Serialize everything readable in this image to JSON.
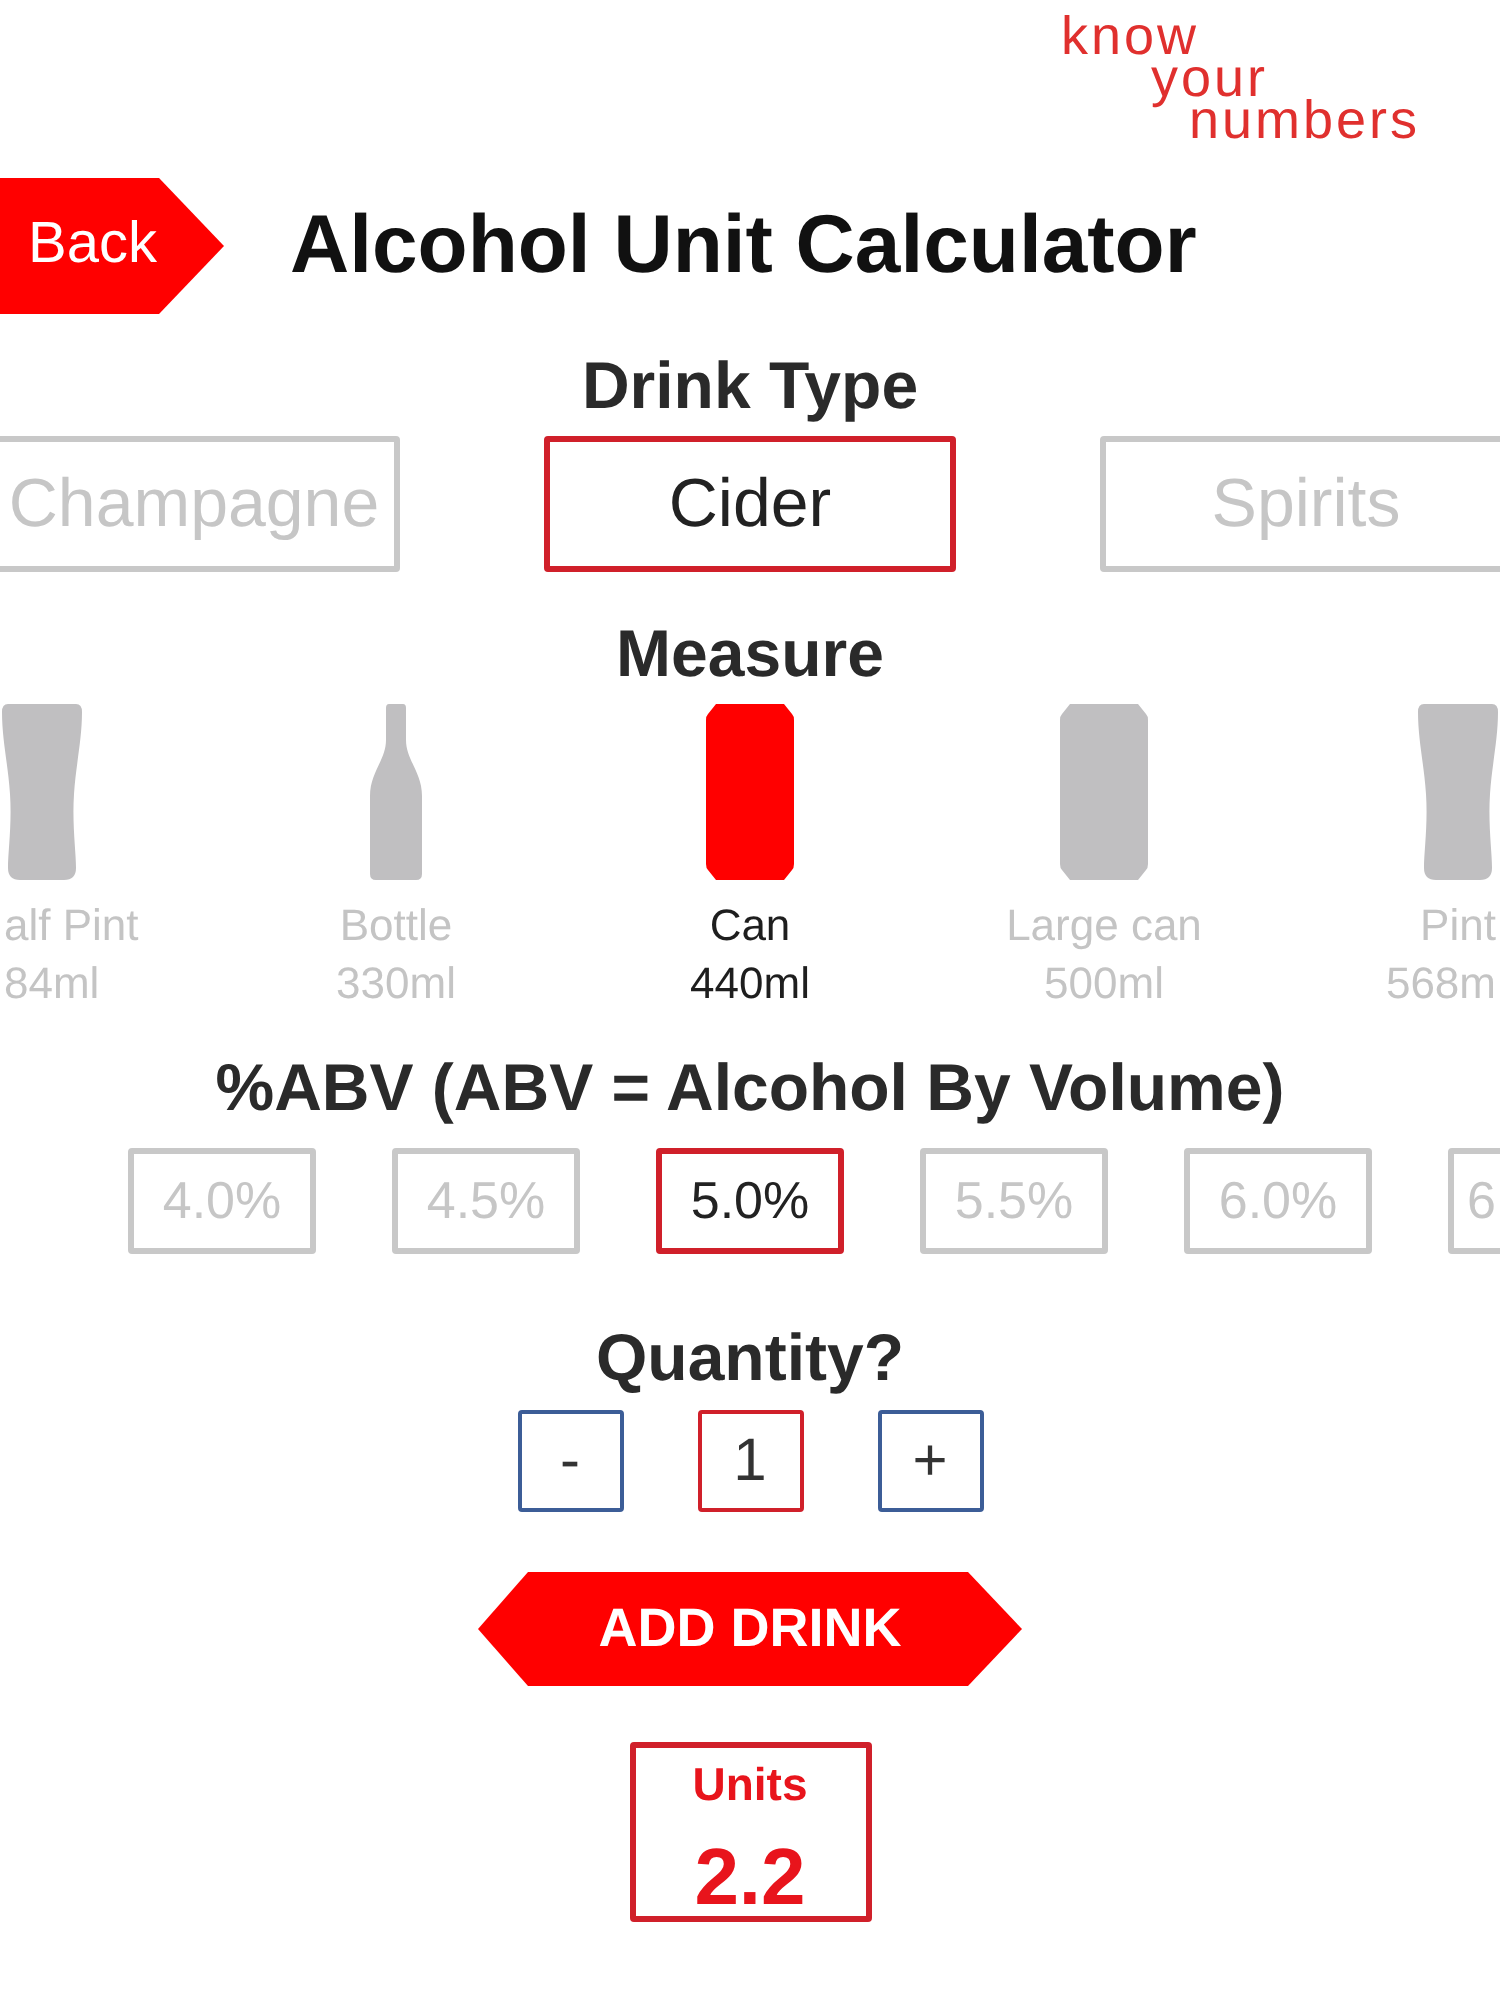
{
  "logo": {
    "lines": [
      "know",
      "your",
      "numbers"
    ]
  },
  "back_button": {
    "label": "Back"
  },
  "title": "Alcohol Unit Calculator",
  "drink_type": {
    "heading": "Drink Type",
    "options": [
      {
        "label": "Champagne",
        "selected": false
      },
      {
        "label": "Cider",
        "selected": true
      },
      {
        "label": "Spirits",
        "selected": false
      }
    ]
  },
  "measure": {
    "heading": "Measure",
    "options": [
      {
        "kind": "glass",
        "name": "alf Pint",
        "volume": "84ml",
        "selected": false
      },
      {
        "kind": "bottle",
        "name": "Bottle",
        "volume": "330ml",
        "selected": false
      },
      {
        "kind": "can",
        "name": "Can",
        "volume": "440ml",
        "selected": true
      },
      {
        "kind": "can",
        "name": "Large can",
        "volume": "500ml",
        "selected": false
      },
      {
        "kind": "glass",
        "name": "Pint",
        "volume": "568m",
        "selected": false
      }
    ]
  },
  "abv": {
    "heading": "%ABV (ABV = Alcohol By Volume)",
    "options": [
      {
        "label": "4.0%",
        "selected": false
      },
      {
        "label": "4.5%",
        "selected": false
      },
      {
        "label": "5.0%",
        "selected": true
      },
      {
        "label": "5.5%",
        "selected": false
      },
      {
        "label": "6.0%",
        "selected": false
      },
      {
        "label": "6",
        "selected": false
      }
    ]
  },
  "quantity": {
    "heading": "Quantity?",
    "decrease": "-",
    "value": "1",
    "increase": "+"
  },
  "add_button": {
    "label": "ADD DRINK"
  },
  "result": {
    "label": "Units",
    "value": "2.2"
  }
}
